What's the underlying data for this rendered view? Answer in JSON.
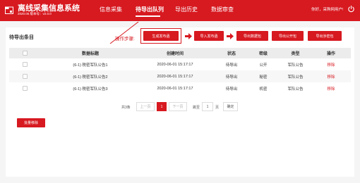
{
  "header": {
    "title": "离线采集信息系统",
    "version": "2020.06 版本号：v2.0.0",
    "nav": [
      "信息采集",
      "待导出队列",
      "导出历史",
      "数据审查"
    ],
    "greeting": "你好，采购网用户!"
  },
  "panel": {
    "title": "待导出条目",
    "steps_label": "操作步骤:",
    "steps": [
      "生成发布函",
      "导入发布函",
      "导出数据包",
      "导出公开包",
      "导出涉密包"
    ]
  },
  "table": {
    "columns": [
      "",
      "数据标题",
      "创建时间",
      "状态",
      "密级",
      "类型",
      "操作"
    ],
    "rows": [
      {
        "title": "(6-1) 税密军队公告1",
        "time": "2020-06-01 15:17:17",
        "status": "待导出",
        "level": "公开",
        "type": "军队公告",
        "action": "移除"
      },
      {
        "title": "(6-1) 税密军队公告2",
        "time": "2020-06-01 15:17:17",
        "status": "待导出",
        "level": "秘密",
        "type": "军队公告",
        "action": "移除"
      },
      {
        "title": "(6-1) 税密军队公告3",
        "time": "2020-06-01 15:17:17",
        "status": "待导出",
        "level": "机密",
        "type": "军队公告",
        "action": "移除"
      }
    ]
  },
  "pagination": {
    "total": "共3条",
    "prev": "上一页",
    "current": "1",
    "next": "下一页",
    "goto": "跳至",
    "goto_value": "1",
    "page_unit": "页",
    "confirm": "确定"
  },
  "batch_remove": "批量移除",
  "colors": {
    "brand": "#d71920"
  }
}
